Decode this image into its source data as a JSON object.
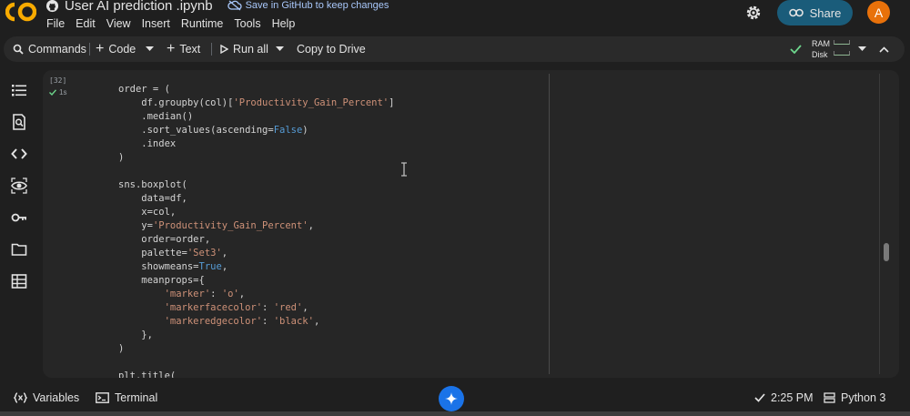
{
  "header": {
    "notebook_title": "User AI prediction .ipynb",
    "save_link": "Save in GitHub to keep changes",
    "share_label": "Share",
    "avatar_letter": "A",
    "brand_color": "#f9ab00"
  },
  "menu": [
    "File",
    "Edit",
    "View",
    "Insert",
    "Runtime",
    "Tools",
    "Help"
  ],
  "toolbar": {
    "commands": "Commands",
    "add_code": "Code",
    "add_text": "Text",
    "run_all": "Run all",
    "copy_to_drive": "Copy to Drive",
    "ram_label": "RAM",
    "disk_label": "Disk"
  },
  "rail_icons": [
    "table-of-contents-icon",
    "find-replace-icon",
    "code-snippets-icon",
    "variables-inspector-icon",
    "secrets-key-icon",
    "files-folder-icon",
    "data-table-icon"
  ],
  "cell": {
    "execution_count": "[32]",
    "execution_time": "1s",
    "code_lines": [
      [
        {
          "t": "order = ("
        }
      ],
      [
        {
          "t": "    df.groupby(col)["
        },
        {
          "t": "'Productivity_Gain_Percent'",
          "c": "st"
        },
        {
          "t": "]"
        }
      ],
      [
        {
          "t": "    .median()"
        }
      ],
      [
        {
          "t": "    .sort_values(ascending="
        },
        {
          "t": "False",
          "c": "kw"
        },
        {
          "t": ")"
        }
      ],
      [
        {
          "t": "    .index"
        }
      ],
      [
        {
          "t": ")"
        }
      ],
      [
        {
          "t": ""
        }
      ],
      [
        {
          "t": "sns.boxplot("
        }
      ],
      [
        {
          "t": "    data=df,"
        }
      ],
      [
        {
          "t": "    x=col,"
        }
      ],
      [
        {
          "t": "    y="
        },
        {
          "t": "'Productivity_Gain_Percent'",
          "c": "st"
        },
        {
          "t": ","
        }
      ],
      [
        {
          "t": "    order=order,"
        }
      ],
      [
        {
          "t": "    palette="
        },
        {
          "t": "'Set3'",
          "c": "st"
        },
        {
          "t": ","
        }
      ],
      [
        {
          "t": "    showmeans="
        },
        {
          "t": "True",
          "c": "kw"
        },
        {
          "t": ","
        }
      ],
      [
        {
          "t": "    meanprops={"
        }
      ],
      [
        {
          "t": "        "
        },
        {
          "t": "'marker'",
          "c": "st"
        },
        {
          "t": ": "
        },
        {
          "t": "'o'",
          "c": "st"
        },
        {
          "t": ","
        }
      ],
      [
        {
          "t": "        "
        },
        {
          "t": "'markerfacecolor'",
          "c": "st"
        },
        {
          "t": ": "
        },
        {
          "t": "'red'",
          "c": "st"
        },
        {
          "t": ","
        }
      ],
      [
        {
          "t": "        "
        },
        {
          "t": "'markeredgecolor'",
          "c": "st"
        },
        {
          "t": ": "
        },
        {
          "t": "'black'",
          "c": "st"
        },
        {
          "t": ","
        }
      ],
      [
        {
          "t": "    },"
        }
      ],
      [
        {
          "t": ")"
        }
      ],
      [
        {
          "t": ""
        }
      ],
      [
        {
          "t": "plt.title("
        }
      ]
    ]
  },
  "statusbar": {
    "variables": "Variables",
    "terminal": "Terminal",
    "time": "2:25 PM",
    "kernel": "Python 3"
  }
}
